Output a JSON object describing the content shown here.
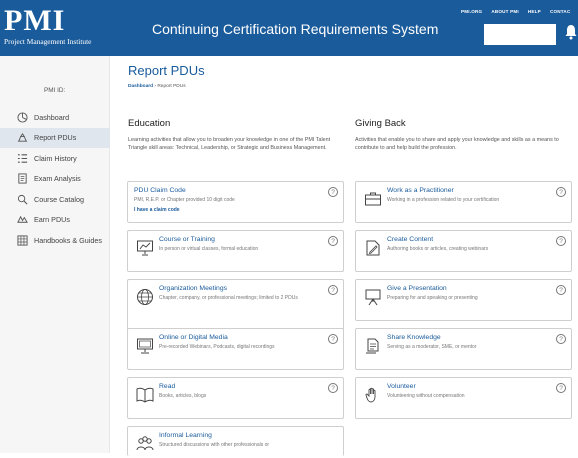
{
  "header": {
    "logo_mark": "PMI",
    "logo_sub": "Project Management Institute",
    "title": "Continuing Certification Requirements System",
    "links": [
      "PMI.ORG",
      "ABOUT PMI",
      "HELP",
      "CONTAC"
    ],
    "colors": {
      "brand": "#1a5b9b"
    }
  },
  "sidebar": {
    "pmi_id_label": "PMI ID:",
    "items": [
      {
        "label": "Dashboard",
        "icon": "dashboard-icon"
      },
      {
        "label": "Report PDUs",
        "icon": "report-pdus-icon",
        "active": true
      },
      {
        "label": "Claim History",
        "icon": "claim-history-icon"
      },
      {
        "label": "Exam Analysis",
        "icon": "exam-analysis-icon"
      },
      {
        "label": "Course Catalog",
        "icon": "course-catalog-icon"
      },
      {
        "label": "Earn PDUs",
        "icon": "earn-pdus-icon"
      },
      {
        "label": "Handbooks & Guides",
        "icon": "handbooks-icon"
      }
    ]
  },
  "main": {
    "title": "Report PDUs",
    "breadcrumb": {
      "parent": "Dashboard",
      "current": "Report PDUs"
    },
    "education": {
      "title": "Education",
      "desc": "Learning activities that allow you to broaden your knowledge in one of the PMI Talent Triangle skill areas: Technical, Leadership, or Strategic and Business Management.",
      "cards": [
        {
          "title": "PDU Claim Code",
          "desc": "PMI, R.E.P. or Chapter provided 10 digit code",
          "link": "I have a claim code"
        },
        {
          "title": "Course or Training",
          "desc": "In person or virtual classes, formal education",
          "icon": "presentation-board-icon"
        },
        {
          "title": "Organization Meetings",
          "desc": "Chapter, company, or professional meetings; limited to 2 PDUs",
          "icon": "globe-icon"
        },
        {
          "title": "Online or Digital Media",
          "desc": "Pre-recorded Webinars, Podcasts, digital recordings",
          "icon": "monitor-icon"
        },
        {
          "title": "Read",
          "desc": "Books, articles, blogs",
          "icon": "open-book-icon"
        },
        {
          "title": "Informal Learning",
          "desc": "Structured discussions with other professionals or",
          "icon": "group-icon"
        }
      ]
    },
    "giving_back": {
      "title": "Giving Back",
      "desc": "Activities that enable you to share and apply your knowledge and skills as a means to contribute to and help build the profession.",
      "cards": [
        {
          "title": "Work as a Practitioner",
          "desc": "Working in a profession related to your certification",
          "icon": "briefcase-icon"
        },
        {
          "title": "Create Content",
          "desc": "Authoring books or articles, creating webinars",
          "icon": "pen-document-icon"
        },
        {
          "title": "Give a Presentation",
          "desc": "Preparing for and speaking or presenting",
          "icon": "easel-icon"
        },
        {
          "title": "Share Knowledge",
          "desc": "Serving as a moderator, SME, or mentor",
          "icon": "share-document-icon"
        },
        {
          "title": "Volunteer",
          "desc": "Volunteering without compensation",
          "icon": "raised-hand-icon"
        }
      ]
    },
    "help_glyph": "?"
  }
}
